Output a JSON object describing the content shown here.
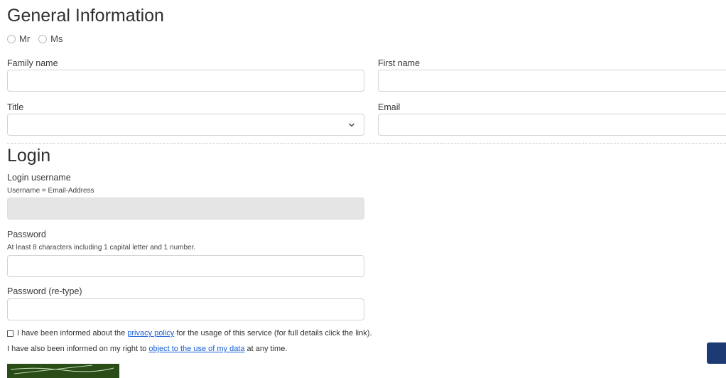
{
  "general": {
    "heading": "General Information",
    "salutations": [
      "Mr",
      "Ms"
    ],
    "family_name_label": "Family name",
    "first_name_label": "First name",
    "title_label": "Title",
    "email_label": "Email"
  },
  "login": {
    "heading": "Login",
    "username_label": "Login username",
    "username_hint": "Username = Email-Address",
    "password_label": "Password",
    "password_hint": "At least 8 characters including 1 capital letter and 1 number.",
    "password_retype_label": "Password (re-type)"
  },
  "consent": {
    "line1_before": "I have been informed about the ",
    "privacy_link": "privacy policy",
    "line1_after": " for the usage of this service (for full details click the link).",
    "line2_before": "I have also been informed on my right to ",
    "object_link": "object to the use of my data",
    "line2_after": " at any time."
  },
  "colors": {
    "accent": "#1e3a74",
    "link": "#1a5fd6",
    "disabled_field": "#e5e5e5"
  },
  "icons": {
    "select_chevron": "chevron-down-icon"
  }
}
